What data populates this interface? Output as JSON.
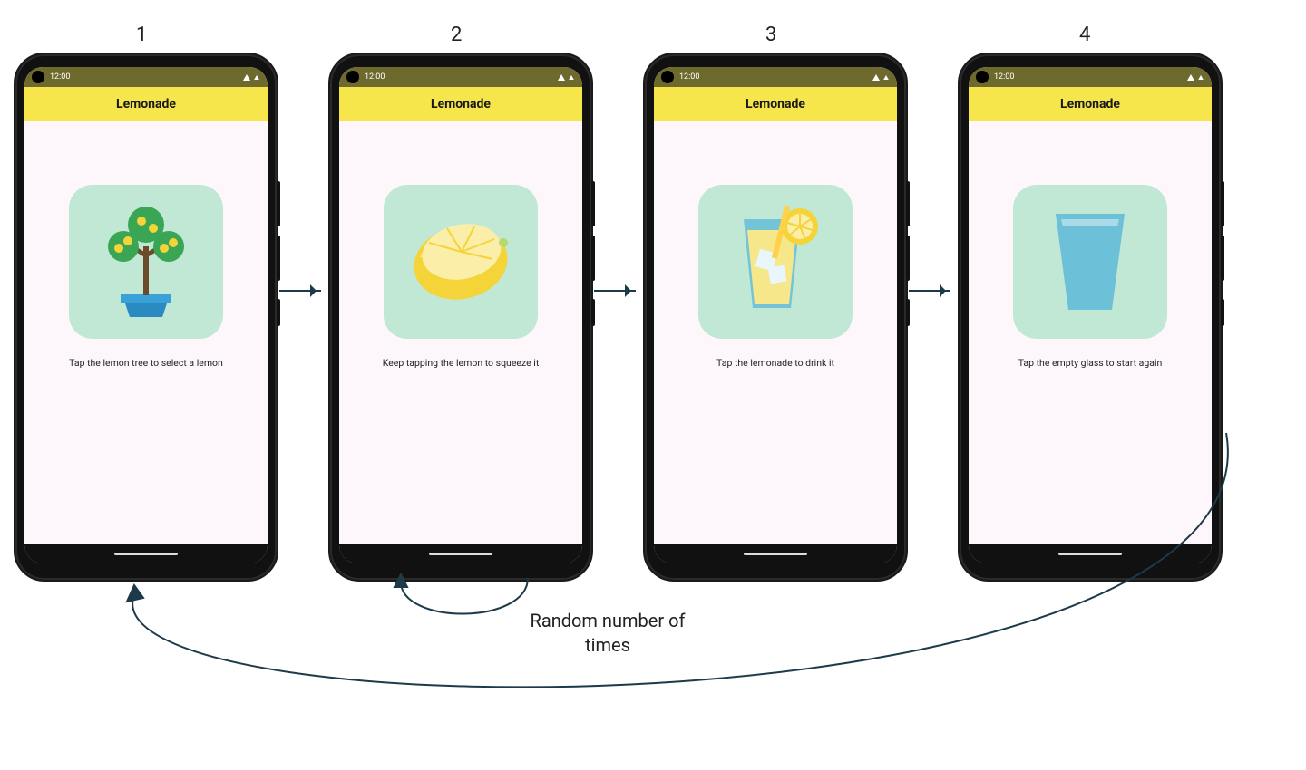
{
  "status": {
    "time": "12:00"
  },
  "app": {
    "title": "Lemonade"
  },
  "steps": [
    {
      "num": "1",
      "caption": "Tap the lemon tree to select a lemon",
      "icon": "lemon-tree-icon"
    },
    {
      "num": "2",
      "caption": "Keep tapping the lemon to squeeze it",
      "icon": "lemon-icon"
    },
    {
      "num": "3",
      "caption": "Tap the lemonade to drink it",
      "icon": "lemonade-glass-icon"
    },
    {
      "num": "4",
      "caption": "Tap the empty glass to start again",
      "icon": "empty-glass-icon"
    }
  ],
  "annotations": {
    "self_loop": "Random number of times"
  }
}
